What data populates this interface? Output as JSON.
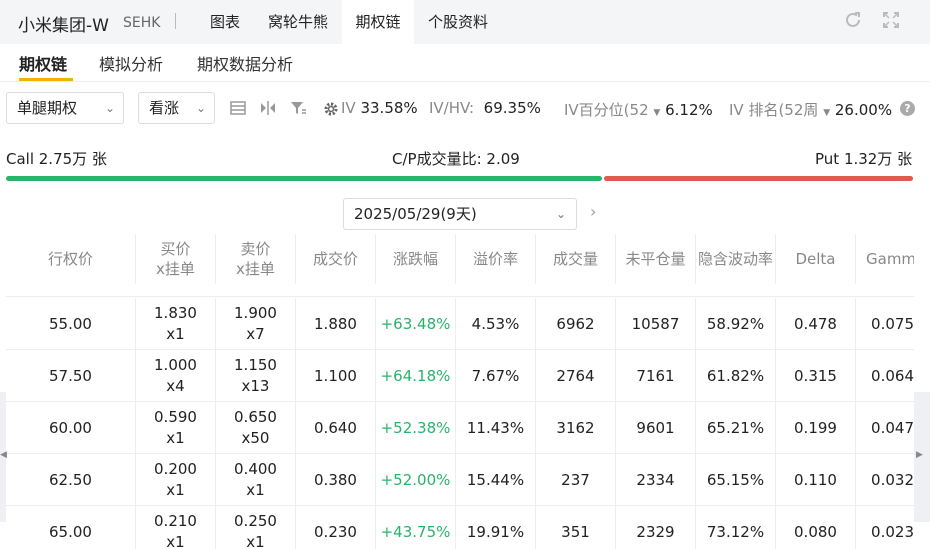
{
  "header": {
    "title": "小米集团-W",
    "exchange": "SEHK",
    "tabs": [
      {
        "label": "图表"
      },
      {
        "label": "窝轮牛熊"
      },
      {
        "label": "期权链"
      },
      {
        "label": "个股资料"
      }
    ],
    "active_tab": "期权链"
  },
  "subtabs": [
    {
      "label": "期权链"
    },
    {
      "label": "模拟分析"
    },
    {
      "label": "期权数据分析"
    }
  ],
  "toolbar": {
    "strategy_select": "单腿期权",
    "direction_select": "看涨",
    "iv": {
      "label": "IV",
      "value": "33.58%"
    },
    "iv_hv": {
      "label": "IV/HV:",
      "value": "69.35%"
    },
    "iv_pct": {
      "label": "IV百分位(52",
      "value": "6.12%"
    },
    "iv_rank": {
      "label": "IV 排名(52周",
      "value": "26.00%"
    }
  },
  "volume": {
    "call": "Call 2.75万 张",
    "ratio": "C/P成交量比: 2.09",
    "put": "Put 1.32万 张"
  },
  "expiry": {
    "value": "2025/05/29(9天)"
  },
  "table": {
    "headers": [
      {
        "l1": "行权价",
        "l2": ""
      },
      {
        "l1": "买价",
        "l2": "x挂单"
      },
      {
        "l1": "卖价",
        "l2": "x挂单"
      },
      {
        "l1": "成交价",
        "l2": ""
      },
      {
        "l1": "涨跌幅",
        "l2": ""
      },
      {
        "l1": "溢价率",
        "l2": ""
      },
      {
        "l1": "成交量",
        "l2": ""
      },
      {
        "l1": "未平仓量",
        "l2": ""
      },
      {
        "l1": "隐含波动率",
        "l2": ""
      },
      {
        "l1": "Delta",
        "l2": ""
      },
      {
        "l1": "Gamma",
        "l2": ""
      }
    ],
    "rows": [
      {
        "strike": "55.00",
        "bid": "1.830",
        "bid_size": "x1",
        "ask": "1.900",
        "ask_size": "x7",
        "last": "1.880",
        "change": "+63.48%",
        "premium": "4.53%",
        "volume": "6962",
        "oi": "10587",
        "iv": "58.92%",
        "delta": "0.478",
        "gamma": "0.075"
      },
      {
        "strike": "57.50",
        "bid": "1.000",
        "bid_size": "x4",
        "ask": "1.150",
        "ask_size": "x13",
        "last": "1.100",
        "change": "+64.18%",
        "premium": "7.67%",
        "volume": "2764",
        "oi": "7161",
        "iv": "61.82%",
        "delta": "0.315",
        "gamma": "0.064"
      },
      {
        "strike": "60.00",
        "bid": "0.590",
        "bid_size": "x1",
        "ask": "0.650",
        "ask_size": "x50",
        "last": "0.640",
        "change": "+52.38%",
        "premium": "11.43%",
        "volume": "3162",
        "oi": "9601",
        "iv": "65.21%",
        "delta": "0.199",
        "gamma": "0.047"
      },
      {
        "strike": "62.50",
        "bid": "0.200",
        "bid_size": "x1",
        "ask": "0.400",
        "ask_size": "x1",
        "last": "0.380",
        "change": "+52.00%",
        "premium": "15.44%",
        "volume": "237",
        "oi": "2334",
        "iv": "65.15%",
        "delta": "0.110",
        "gamma": "0.032"
      },
      {
        "strike": "65.00",
        "bid": "0.210",
        "bid_size": "x1",
        "ask": "0.250",
        "ask_size": "x1",
        "last": "0.230",
        "change": "+43.75%",
        "premium": "19.91%",
        "volume": "351",
        "oi": "2329",
        "iv": "73.12%",
        "delta": "0.080",
        "gamma": "0.023"
      }
    ]
  },
  "colors": {
    "up": "#27b56a",
    "down": "#e05a50",
    "accent": "#f0b400"
  }
}
